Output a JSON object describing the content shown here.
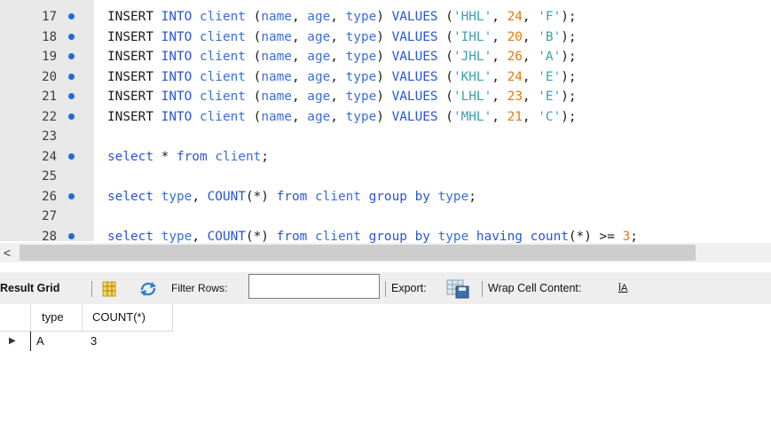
{
  "editor": {
    "lines": [
      {
        "num": "17",
        "marker": true,
        "tokens": [
          [
            "kw",
            "INSERT "
          ],
          [
            "kw2",
            "INTO "
          ],
          [
            "ident",
            "client "
          ],
          [
            "p",
            "("
          ],
          [
            "ident",
            "name"
          ],
          [
            "p",
            ", "
          ],
          [
            "ident",
            "age"
          ],
          [
            "p",
            ", "
          ],
          [
            "ident",
            "type"
          ],
          [
            "p",
            ") "
          ],
          [
            "kw2",
            "VALUES "
          ],
          [
            "p",
            "("
          ],
          [
            "str",
            "'HHL'"
          ],
          [
            "p",
            ", "
          ],
          [
            "num",
            "24"
          ],
          [
            "p",
            ", "
          ],
          [
            "str",
            "'F'"
          ],
          [
            "p",
            ");"
          ]
        ]
      },
      {
        "num": "18",
        "marker": true,
        "tokens": [
          [
            "kw",
            "INSERT "
          ],
          [
            "kw2",
            "INTO "
          ],
          [
            "ident",
            "client "
          ],
          [
            "p",
            "("
          ],
          [
            "ident",
            "name"
          ],
          [
            "p",
            ", "
          ],
          [
            "ident",
            "age"
          ],
          [
            "p",
            ", "
          ],
          [
            "ident",
            "type"
          ],
          [
            "p",
            ") "
          ],
          [
            "kw2",
            "VALUES "
          ],
          [
            "p",
            "("
          ],
          [
            "str",
            "'IHL'"
          ],
          [
            "p",
            ", "
          ],
          [
            "num",
            "20"
          ],
          [
            "p",
            ", "
          ],
          [
            "str",
            "'B'"
          ],
          [
            "p",
            ");"
          ]
        ]
      },
      {
        "num": "19",
        "marker": true,
        "tokens": [
          [
            "kw",
            "INSERT "
          ],
          [
            "kw2",
            "INTO "
          ],
          [
            "ident",
            "client "
          ],
          [
            "p",
            "("
          ],
          [
            "ident",
            "name"
          ],
          [
            "p",
            ", "
          ],
          [
            "ident",
            "age"
          ],
          [
            "p",
            ", "
          ],
          [
            "ident",
            "type"
          ],
          [
            "p",
            ") "
          ],
          [
            "kw2",
            "VALUES "
          ],
          [
            "p",
            "("
          ],
          [
            "str",
            "'JHL'"
          ],
          [
            "p",
            ", "
          ],
          [
            "num",
            "26"
          ],
          [
            "p",
            ", "
          ],
          [
            "str",
            "'A'"
          ],
          [
            "p",
            ");"
          ]
        ]
      },
      {
        "num": "20",
        "marker": true,
        "tokens": [
          [
            "kw",
            "INSERT "
          ],
          [
            "kw2",
            "INTO "
          ],
          [
            "ident",
            "client "
          ],
          [
            "p",
            "("
          ],
          [
            "ident",
            "name"
          ],
          [
            "p",
            ", "
          ],
          [
            "ident",
            "age"
          ],
          [
            "p",
            ", "
          ],
          [
            "ident",
            "type"
          ],
          [
            "p",
            ") "
          ],
          [
            "kw2",
            "VALUES "
          ],
          [
            "p",
            "("
          ],
          [
            "str",
            "'KHL'"
          ],
          [
            "p",
            ", "
          ],
          [
            "num",
            "24"
          ],
          [
            "p",
            ", "
          ],
          [
            "str",
            "'E'"
          ],
          [
            "p",
            ");"
          ]
        ]
      },
      {
        "num": "21",
        "marker": true,
        "tokens": [
          [
            "kw",
            "INSERT "
          ],
          [
            "kw2",
            "INTO "
          ],
          [
            "ident",
            "client "
          ],
          [
            "p",
            "("
          ],
          [
            "ident",
            "name"
          ],
          [
            "p",
            ", "
          ],
          [
            "ident",
            "age"
          ],
          [
            "p",
            ", "
          ],
          [
            "ident",
            "type"
          ],
          [
            "p",
            ") "
          ],
          [
            "kw2",
            "VALUES "
          ],
          [
            "p",
            "("
          ],
          [
            "str",
            "'LHL'"
          ],
          [
            "p",
            ", "
          ],
          [
            "num",
            "23"
          ],
          [
            "p",
            ", "
          ],
          [
            "str",
            "'E'"
          ],
          [
            "p",
            ");"
          ]
        ]
      },
      {
        "num": "22",
        "marker": true,
        "tokens": [
          [
            "kw",
            "INSERT "
          ],
          [
            "kw2",
            "INTO "
          ],
          [
            "ident",
            "client "
          ],
          [
            "p",
            "("
          ],
          [
            "ident",
            "name"
          ],
          [
            "p",
            ", "
          ],
          [
            "ident",
            "age"
          ],
          [
            "p",
            ", "
          ],
          [
            "ident",
            "type"
          ],
          [
            "p",
            ") "
          ],
          [
            "kw2",
            "VALUES "
          ],
          [
            "p",
            "("
          ],
          [
            "str",
            "'MHL'"
          ],
          [
            "p",
            ", "
          ],
          [
            "num",
            "21"
          ],
          [
            "p",
            ", "
          ],
          [
            "str",
            "'C'"
          ],
          [
            "p",
            ");"
          ]
        ]
      },
      {
        "num": "23",
        "marker": false,
        "tokens": []
      },
      {
        "num": "24",
        "marker": true,
        "tokens": [
          [
            "kw2",
            "select "
          ],
          [
            "p",
            "* "
          ],
          [
            "kw2",
            "from "
          ],
          [
            "ident",
            "client"
          ],
          [
            "p",
            ";"
          ]
        ]
      },
      {
        "num": "25",
        "marker": false,
        "tokens": []
      },
      {
        "num": "26",
        "marker": true,
        "tokens": [
          [
            "kw2",
            "select "
          ],
          [
            "ident",
            "type"
          ],
          [
            "p",
            ", "
          ],
          [
            "kw2",
            "COUNT"
          ],
          [
            "p",
            "(*) "
          ],
          [
            "kw2",
            "from "
          ],
          [
            "ident",
            "client "
          ],
          [
            "kw2",
            "group "
          ],
          [
            "kw2",
            "by "
          ],
          [
            "ident",
            "type"
          ],
          [
            "p",
            ";"
          ]
        ]
      },
      {
        "num": "27",
        "marker": false,
        "tokens": []
      },
      {
        "num": "28",
        "marker": true,
        "tokens": [
          [
            "kw2",
            "select "
          ],
          [
            "ident",
            "type"
          ],
          [
            "p",
            ", "
          ],
          [
            "kw2",
            "COUNT"
          ],
          [
            "p",
            "(*) "
          ],
          [
            "kw2",
            "from "
          ],
          [
            "ident",
            "client "
          ],
          [
            "kw2",
            "group "
          ],
          [
            "kw2",
            "by "
          ],
          [
            "ident",
            "type "
          ],
          [
            "kw2",
            "having "
          ],
          [
            "kw2",
            "count"
          ],
          [
            "p",
            "(*) >= "
          ],
          [
            "num",
            "3"
          ],
          [
            "p",
            ";"
          ]
        ]
      }
    ]
  },
  "scrollbar": {
    "left_arrow": "<"
  },
  "toolbar": {
    "result_grid_label": "Result Grid",
    "grid_icon": "grid-layout-icon",
    "refresh_icon": "refresh-icon",
    "filter_label": "Filter Rows:",
    "filter_value": "",
    "export_label": "Export:",
    "export_icon": "export-grid-icon",
    "wrap_label": "Wrap Cell Content:",
    "wrap_icon": "wrap-text-icon",
    "wrap_glyph": "ĪA"
  },
  "grid": {
    "columns": [
      "type",
      "COUNT(*)"
    ],
    "rows": [
      [
        "A",
        "3"
      ]
    ],
    "row_pointer": "▶"
  },
  "colors": {
    "keyword": "#2a55d6",
    "identifier": "#3a6fd8",
    "string": "#3aa1ad",
    "number": "#e07b0d",
    "marker": "#1c6cd6"
  }
}
